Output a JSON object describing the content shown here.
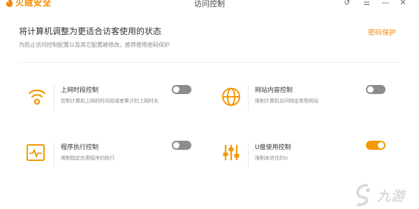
{
  "window": {
    "app_name": "火绒安全",
    "title": "访问控制",
    "controls": [
      "↺",
      "☰",
      "—",
      "✕"
    ]
  },
  "header": {
    "headline": "将计算机调整为更适合访客使用的状态",
    "subline": "为防止访问控制配置以及其它配置被修改，推荐使用密码保护",
    "password_link": "密码保护"
  },
  "features": [
    {
      "icon": "wifi-icon",
      "title": "上网时段控制",
      "desc": "控制计算机上网的时间段或者累计的上网时长",
      "enabled": false
    },
    {
      "icon": "globe-icon",
      "title": "网站内容控制",
      "desc": "限制计算机访问特定类型网站",
      "enabled": false
    },
    {
      "icon": "program-monitor-icon",
      "title": "程序执行控制",
      "desc": "限制指定应用程序的执行",
      "enabled": false
    },
    {
      "icon": "usb-sliders-icon",
      "title": "U盘使用控制",
      "desc": "限制未信任的U",
      "enabled": true
    }
  ],
  "watermark": {
    "text": "九游"
  },
  "colors": {
    "accent": "#f39800",
    "toggle_off": "#8c8c8c"
  }
}
